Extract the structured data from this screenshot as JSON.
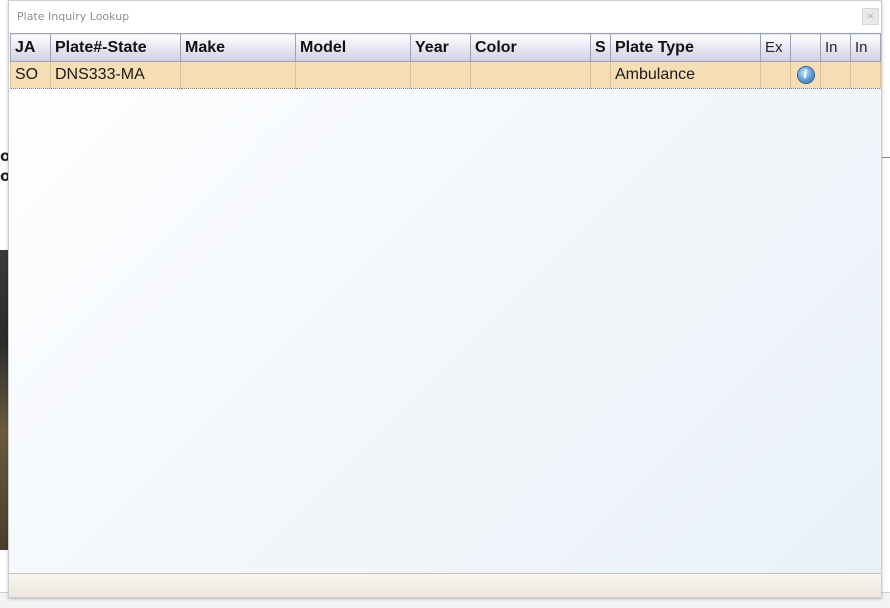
{
  "dialog": {
    "title": "Plate Inquiry Lookup",
    "close_symbol": "×"
  },
  "grid": {
    "columns": [
      {
        "key": "ja",
        "label": "JA"
      },
      {
        "key": "plate_state",
        "label": "Plate#-State"
      },
      {
        "key": "make",
        "label": "Make"
      },
      {
        "key": "model",
        "label": "Model"
      },
      {
        "key": "year",
        "label": "Year"
      },
      {
        "key": "color",
        "label": "Color"
      },
      {
        "key": "s",
        "label": "S"
      },
      {
        "key": "plate_type",
        "label": "Plate Type"
      },
      {
        "key": "ex",
        "label": "Ex"
      },
      {
        "key": "info",
        "label": ""
      },
      {
        "key": "in1",
        "label": "In"
      },
      {
        "key": "in2",
        "label": "In"
      }
    ],
    "rows": [
      {
        "ja": "SO",
        "plate_state": "DNS333-MA",
        "make": "",
        "model": "",
        "year": "",
        "color": "",
        "s": "",
        "plate_type": "Ambulance",
        "ex": "",
        "info_icon": "info-icon",
        "in1": "",
        "in2": ""
      }
    ],
    "selected_row_color": "#f5deb3"
  }
}
